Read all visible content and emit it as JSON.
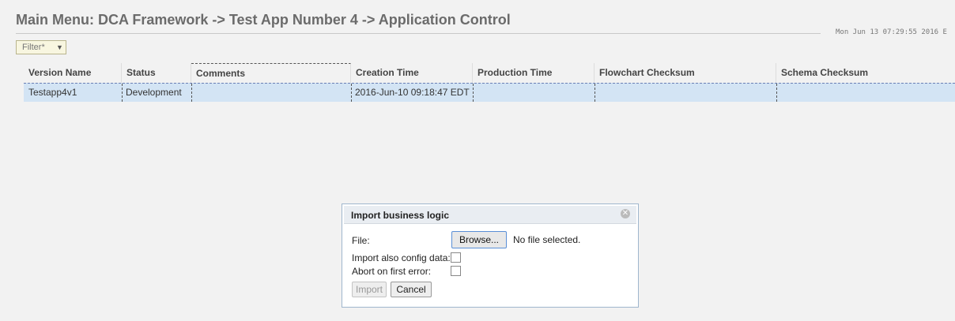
{
  "header": {
    "title": "Main Menu: DCA Framework -> Test App Number 4 -> Application Control",
    "timestamp": "Mon Jun 13 07:29:55 2016 E"
  },
  "filter": {
    "label": "Filter*",
    "caret": "▼"
  },
  "table": {
    "columns": [
      "Version Name",
      "Status",
      "Comments",
      "Creation Time",
      "Production Time",
      "Flowchart Checksum",
      "Schema Checksum"
    ],
    "rows": [
      {
        "version_name": "Testapp4v1",
        "status": "Development",
        "comments": "",
        "creation_time": "2016-Jun-10 09:18:47 EDT",
        "production_time": "",
        "flowchart_checksum": "",
        "schema_checksum": ""
      }
    ]
  },
  "dialog": {
    "title": "Import business logic",
    "close_symbol": "✕",
    "file_label": "File:",
    "browse_label": "Browse...",
    "file_status": "No file selected.",
    "config_label": "Import also config data:",
    "abort_label": "Abort on first error:",
    "import_label": "Import",
    "cancel_label": "Cancel"
  },
  "colors": {
    "selected_row": "#d3e4f4",
    "dialog_border": "#9fb6cd",
    "filter_bg": "#f8f6e0"
  }
}
